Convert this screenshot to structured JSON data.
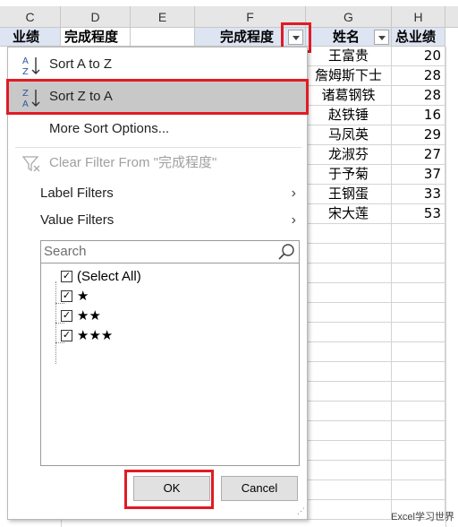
{
  "columns": [
    "C",
    "D",
    "E",
    "F",
    "G",
    "H"
  ],
  "header_row": {
    "c": "业绩",
    "d": "完成程度",
    "f": "完成程度",
    "g": "姓名",
    "h": "总业绩"
  },
  "rows": [
    {
      "name": "王富贵",
      "total": "20"
    },
    {
      "name": "詹姆斯下士",
      "total": "28"
    },
    {
      "name": "诸葛钢铁",
      "total": "28"
    },
    {
      "name": "赵铁锤",
      "total": "16"
    },
    {
      "name": "马凤英",
      "total": "29"
    },
    {
      "name": "龙淑芬",
      "total": "27"
    },
    {
      "name": "于予菊",
      "total": "37"
    },
    {
      "name": "王钢蛋",
      "total": "33"
    },
    {
      "name": "宋大莲",
      "total": "53"
    }
  ],
  "menu": {
    "sort_az": "Sort A to Z",
    "sort_za": "Sort Z to A",
    "more_sort": "More Sort Options...",
    "clear_filter": "Clear Filter From \"完成程度\"",
    "label_filters": "Label Filters",
    "value_filters": "Value Filters",
    "search_placeholder": "Search",
    "items": [
      "(Select All)",
      "★",
      "★★",
      "★★★"
    ],
    "ok": "OK",
    "cancel": "Cancel"
  },
  "watermark": "Excel学习世界",
  "colors": {
    "highlight_box": "#e01b24",
    "header_fill": "#dde4f2",
    "selected_menu_item": "#c8c8c8"
  }
}
